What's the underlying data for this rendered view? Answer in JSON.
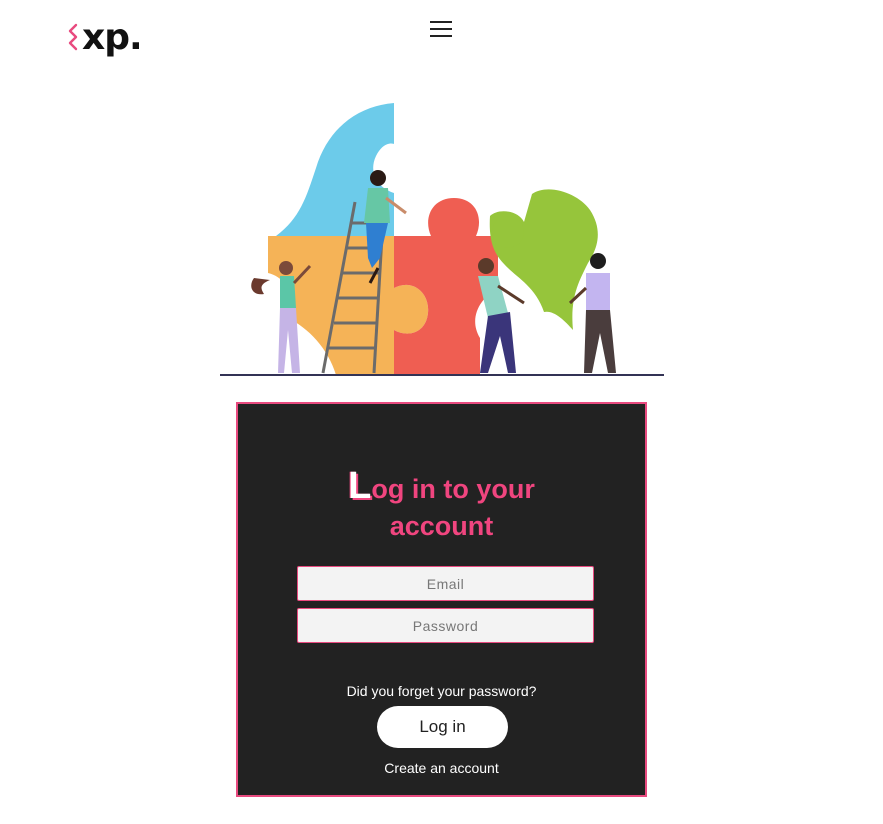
{
  "header": {
    "logo_text": "xp.",
    "logo_mark_color": "#e84a7f",
    "menu_icon": "hamburger-menu-icon"
  },
  "illustration": {
    "description_icon": "team-puzzle-illustration",
    "colors": {
      "blue": "#6ccbea",
      "orange": "#f5b357",
      "red": "#ef5e52",
      "green": "#96c53b",
      "ground": "#333355"
    }
  },
  "login": {
    "title_first_letter": "L",
    "title_rest_line1": "og in to your",
    "title_line2": "account",
    "email_placeholder": "Email",
    "password_placeholder": "Password",
    "forgot_text": "Did you forget your password?",
    "login_button": "Log in",
    "create_account": "Create an account"
  },
  "colors": {
    "accent": "#e84a7f",
    "card_bg": "#222222",
    "field_bg": "#f3f3f3"
  }
}
